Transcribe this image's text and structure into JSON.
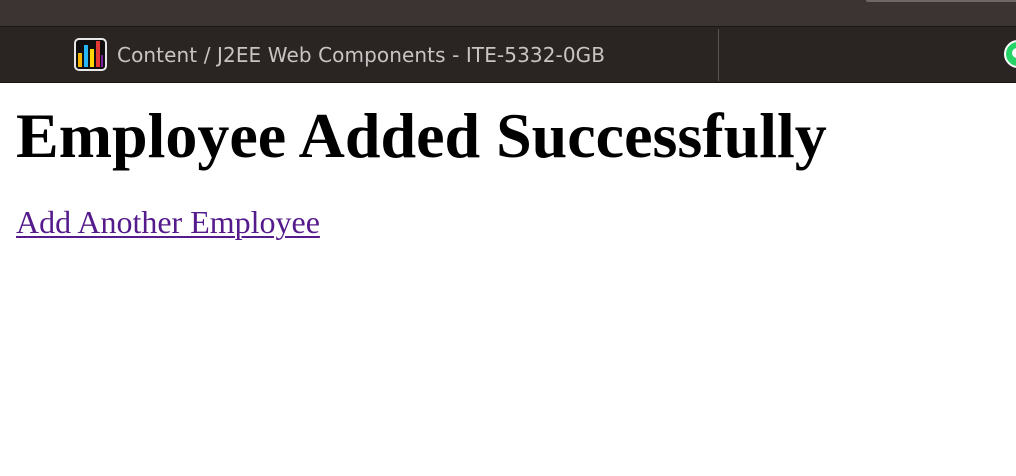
{
  "bookmarks_bar": {
    "items": [
      {
        "label": "Content / J2EE Web Components - ITE-5332-0GB",
        "icon": "bar-chart-icon"
      }
    ],
    "overflow_icon": "whatsapp-icon"
  },
  "page": {
    "title": "Employee Added Successfully",
    "link_label": "Add Another Employee"
  },
  "colors": {
    "visited_link": "#551a8b",
    "toolbar_bg": "#2a2423",
    "bookmark_text": "#c9c4c3",
    "whatsapp": "#25d366",
    "icon_bar_colors": [
      "#f4b400",
      "#29b6f6",
      "#ffd600",
      "#e53935",
      "#7b1fa2"
    ]
  }
}
